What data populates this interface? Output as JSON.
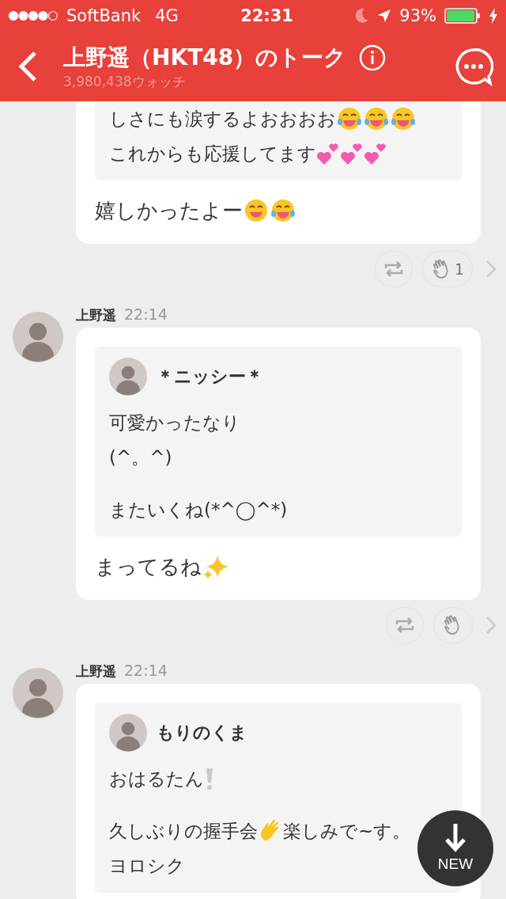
{
  "status_bar": {
    "carrier": "SoftBank",
    "network": "4G",
    "time": "22:31",
    "battery": "93%"
  },
  "header": {
    "title": "上野遥（HKT48）のトーク",
    "watchers": "3,980,438ウォッチ"
  },
  "messages": [
    {
      "quote": {
        "paragraphs": [
          [
            [
              {
                "kind": "text",
                "text": "しさにも涙するよおおおお"
              },
              {
                "kind": "tears-of-joy"
              },
              {
                "kind": "tears-of-joy"
              },
              {
                "kind": "tears-of-joy"
              }
            ],
            [
              {
                "kind": "text",
                "text": "これからも応援してます"
              },
              {
                "kind": "two-hearts"
              },
              {
                "kind": "two-hearts"
              },
              {
                "kind": "two-hearts"
              }
            ]
          ]
        ]
      },
      "lines": [
        [
          {
            "kind": "text",
            "text": "嬉しかったよー"
          },
          {
            "kind": "grin"
          },
          {
            "kind": "tears-of-joy"
          }
        ]
      ],
      "show_actions": true,
      "clap_count": "1"
    },
    {
      "author": "上野遥",
      "time": "22:14",
      "quote": {
        "author": "＊ニッシー＊",
        "paragraphs": [
          [
            [
              {
                "kind": "text",
                "text": "可愛かったなり"
              }
            ],
            [
              {
                "kind": "text",
                "text": "(^。^)"
              }
            ]
          ],
          [
            [
              {
                "kind": "text",
                "text": "またいくね(*^◯^*)"
              }
            ]
          ]
        ]
      },
      "lines": [
        [
          {
            "kind": "text",
            "text": "まってるね"
          },
          {
            "kind": "sparkles"
          }
        ]
      ],
      "show_actions": true
    },
    {
      "author": "上野遥",
      "time": "22:14",
      "quote": {
        "author": "もりのくま",
        "paragraphs": [
          [
            [
              {
                "kind": "text",
                "text": "おはるたん"
              },
              {
                "kind": "exclamation"
              }
            ]
          ],
          [
            [
              {
                "kind": "text",
                "text": "久しぶりの握手会"
              },
              {
                "kind": "wave"
              },
              {
                "kind": "text",
                "text": "楽しみで~す。"
              }
            ],
            [
              {
                "kind": "text",
                "text": "ヨロシク"
              }
            ]
          ]
        ]
      }
    }
  ],
  "new_button": {
    "label": "NEW"
  }
}
